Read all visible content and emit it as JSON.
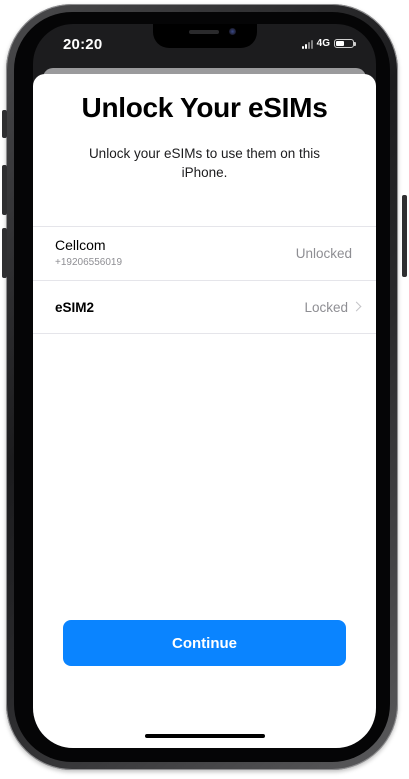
{
  "status_bar": {
    "time": "20:20",
    "network": "4G"
  },
  "sheet": {
    "title": "Unlock Your eSIMs",
    "subtitle": "Unlock your eSIMs to use them on this iPhone."
  },
  "sims": [
    {
      "name": "Cellcom",
      "number": "+19206556019",
      "status": "Unlocked"
    },
    {
      "name": "eSIM2",
      "status": "Locked"
    }
  ],
  "actions": {
    "continue_label": "Continue"
  },
  "colors": {
    "accent": "#0a84ff",
    "secondary_text": "#8e8e93"
  },
  "icons": {
    "chevron": "chevron-right-icon",
    "signal": "cellular-signal-icon",
    "battery": "battery-icon"
  }
}
